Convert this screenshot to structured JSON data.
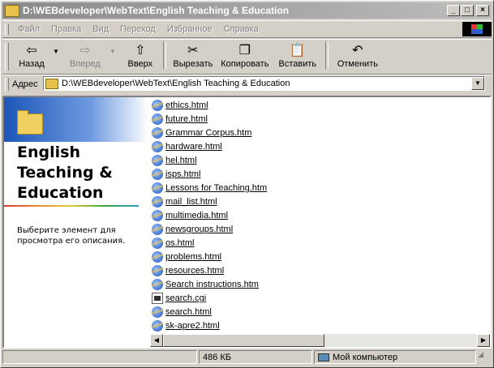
{
  "window": {
    "title": "D:\\WEBdeveloper\\WebText\\English Teaching & Education"
  },
  "title_buttons": {
    "minimize": "_",
    "maximize": "□",
    "close": "×"
  },
  "menu": [
    "Файл",
    "Правка",
    "Вид",
    "Переход",
    "Избранное",
    "Справка"
  ],
  "toolbar": {
    "back": "Назад",
    "forward": "Вперед",
    "up": "Вверх",
    "cut": "Вырезать",
    "copy": "Копировать",
    "paste": "Вставить",
    "undo": "Отменить"
  },
  "address": {
    "label": "Адрес",
    "value": "D:\\WEBdeveloper\\WebText\\English Teaching & Education"
  },
  "left_pane": {
    "heading_line1": "English",
    "heading_line2": "Teaching &",
    "heading_line3": "Education",
    "description": "Выберите элемент для просмотра его описания."
  },
  "files": [
    "ethics.html",
    "future.html",
    "Grammar Corpus.htm",
    "hardware.html",
    "hel.html",
    "isps.html",
    "Lessons for Teaching.htm",
    "mail_list.html",
    "multimedia.html",
    "newsgroups.html",
    "os.html",
    "problems.html",
    "resources.html",
    "Search instructions.htm",
    "search.cgi",
    "search.html",
    "sk-apre2.html"
  ],
  "status": {
    "size": "486 КБ",
    "location": "Мой компьютер"
  }
}
